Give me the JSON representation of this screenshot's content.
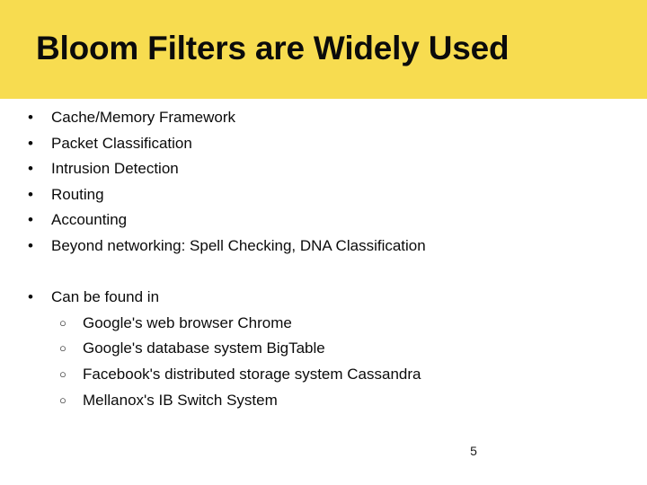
{
  "slide": {
    "title": "Bloom Filters are Widely Used",
    "banner_color": "#f7dc50",
    "text_color": "#0b0b0b",
    "background_color": "#ffffff",
    "page_number": "5",
    "bullet_marker_level1": "•",
    "bullet_marker_level2": "○",
    "content": [
      {
        "level": 1,
        "text": "Cache/Memory Framework"
      },
      {
        "level": 1,
        "text": "Packet Classification"
      },
      {
        "level": 1,
        "text": "Intrusion Detection"
      },
      {
        "level": 1,
        "text": "Routing"
      },
      {
        "level": 1,
        "text": "Accounting"
      },
      {
        "level": 1,
        "text": "Beyond networking: Spell Checking, DNA Classification"
      },
      {
        "level": 0,
        "text": ""
      },
      {
        "level": 1,
        "text": "Can be found in"
      },
      {
        "level": 2,
        "text": "Google's web browser Chrome"
      },
      {
        "level": 2,
        "text": "Google's database system BigTable"
      },
      {
        "level": 2,
        "text": "Facebook's distributed storage system Cassandra"
      },
      {
        "level": 2,
        "text": "Mellanox's IB Switch System"
      }
    ]
  }
}
